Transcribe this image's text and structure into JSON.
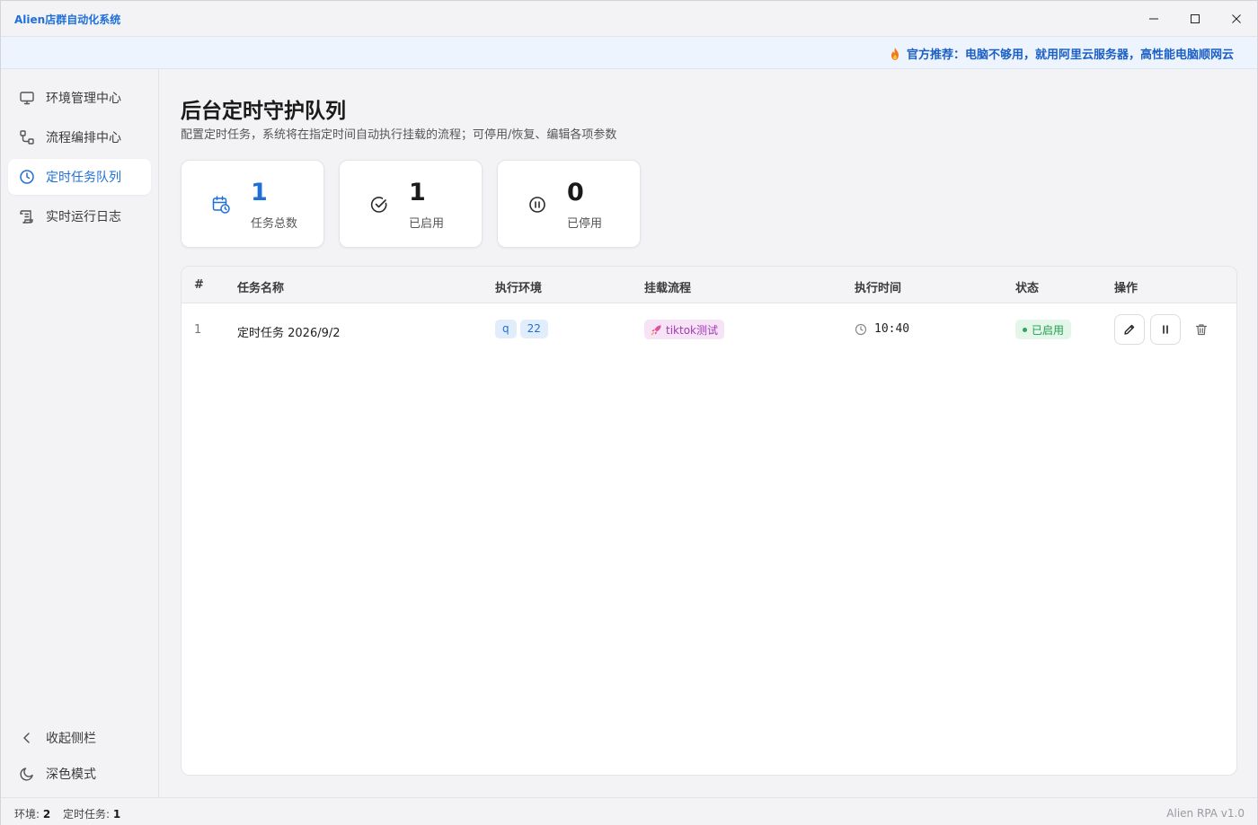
{
  "app": {
    "title": "Alien店群自动化系统",
    "version": "Alien RPA v1.0"
  },
  "banner": {
    "text": "官方推荐：电脑不够用，就用阿里云服务器，高性能电脑顺网云"
  },
  "sidebar": {
    "items": [
      {
        "label": "环境管理中心",
        "icon": "monitor-icon"
      },
      {
        "label": "流程编排中心",
        "icon": "workflow-icon"
      },
      {
        "label": "定时任务队列",
        "icon": "clock-icon",
        "active": true
      },
      {
        "label": "实时运行日志",
        "icon": "scroll-icon"
      }
    ],
    "collapse_label": "收起侧栏",
    "dark_mode_label": "深色模式"
  },
  "page": {
    "title": "后台定时守护队列",
    "subtitle": "配置定时任务，系统将在指定时间自动执行挂载的流程；可停用/恢复、编辑各项参数"
  },
  "stats": [
    {
      "value": "1",
      "label": "任务总数",
      "icon": "calendar-clock-icon"
    },
    {
      "value": "1",
      "label": "已启用",
      "icon": "check-circle-icon"
    },
    {
      "value": "0",
      "label": "已停用",
      "icon": "pause-circle-icon"
    }
  ],
  "table": {
    "headers": [
      "#",
      "任务名称",
      "执行环境",
      "挂载流程",
      "执行时间",
      "状态",
      "操作"
    ],
    "rows": [
      {
        "index": "1",
        "name": "定时任务 2026/9/2",
        "envs": [
          "q",
          "22"
        ],
        "flow": "tiktok测试",
        "time": "10:40",
        "status": "已启用"
      }
    ]
  },
  "statusbar": {
    "env_label": "环境:",
    "env_count": "2",
    "task_label": "定时任务:",
    "task_count": "1"
  },
  "colors": {
    "accent": "#1f6fd8",
    "success": "#1f9d4c",
    "flow_tag": "#a33ab2"
  }
}
